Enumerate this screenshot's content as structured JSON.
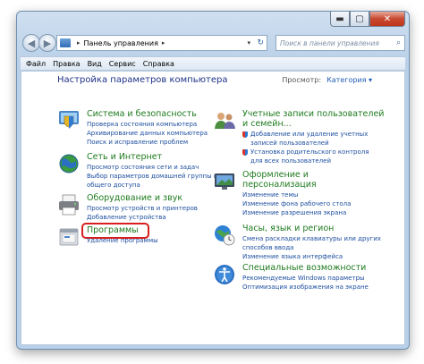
{
  "window": {
    "address": [
      "Панель управления"
    ],
    "search_placeholder": "Поиск в панели управления"
  },
  "menu": [
    "Файл",
    "Правка",
    "Вид",
    "Сервис",
    "Справка"
  ],
  "content": {
    "heading": "Настройка параметров компьютера",
    "view_label": "Просмотр:",
    "view_value": "Категория ▾"
  },
  "categories_left": [
    {
      "title": "Система и безопасность",
      "icon": "security-shield-icon",
      "links": [
        "Проверка состояния компьютера",
        "Архивирование данных компьютера",
        "Поиск и исправление проблем"
      ]
    },
    {
      "title": "Сеть и Интернет",
      "icon": "network-globe-icon",
      "links": [
        "Просмотр состояния сети и задач",
        "Выбор параметров домашней группы и",
        "общего доступа"
      ]
    },
    {
      "title": "Оборудование и звук",
      "icon": "printer-icon",
      "links": [
        "Просмотр устройств и принтеров",
        "Добавление устройства"
      ]
    },
    {
      "title": "Программы",
      "icon": "programs-icon",
      "links": [
        "Удаление программы"
      ]
    }
  ],
  "categories_right": [
    {
      "title": "Учетные записи пользователей",
      "title2": "и семейн...",
      "icon": "users-icon",
      "links": [
        "Добавление или удаление учетных",
        "записей пользователей",
        "Установка родительского контроля",
        "для всех пользователей"
      ]
    },
    {
      "title": "Оформление и",
      "title2": "персонализация",
      "icon": "appearance-icon",
      "links": [
        "Изменение темы",
        "Изменение фона рабочего стола",
        "Изменение разрешения экрана"
      ]
    },
    {
      "title": "Часы, язык и регион",
      "icon": "clock-globe-icon",
      "links": [
        "Смена раскладки клавиатуры или других",
        "способов ввода",
        "Изменение языка интерфейса"
      ]
    },
    {
      "title": "Специальные возможности",
      "icon": "accessibility-icon",
      "links": [
        "Рекомендуемые Windows параметры",
        "Оптимизация изображения на экране"
      ]
    }
  ]
}
